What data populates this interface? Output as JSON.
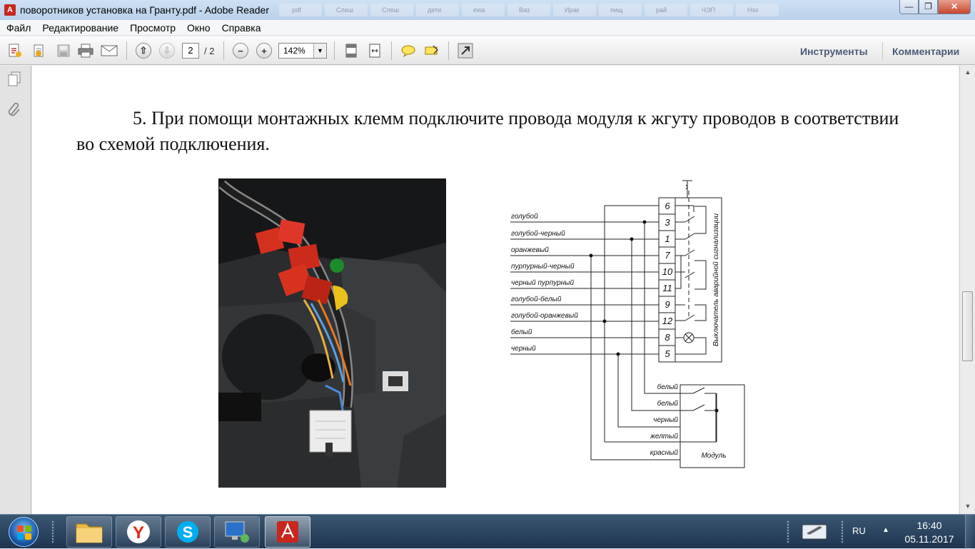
{
  "window": {
    "title": "поворотников установка на Гранту.pdf - Adobe Reader",
    "bg_tab_labels": [
      ".pdf",
      "Слеш",
      "Слеш",
      "дети",
      "ewa",
      "Ваз",
      "Ирак",
      "пищ",
      "рай",
      "ЧЭП",
      "Нэз"
    ]
  },
  "menu": {
    "items": [
      "Файл",
      "Редактирование",
      "Просмотр",
      "Окно",
      "Справка"
    ]
  },
  "toolbar": {
    "current_page": "2",
    "total_pages": "/ 2",
    "zoom": "142%",
    "tools_label": "Инструменты",
    "comments_label": "Комментарии"
  },
  "document": {
    "paragraph": "5. При помощи монтажных клемм подключите провода модуля к жгуту проводов в соответствии во схемой подключения.",
    "diagram": {
      "wire_labels": [
        "голубой",
        "голубой-черный",
        "оранжевый",
        "пурпурный-черный",
        "черный пурпурный",
        "голубой-белый",
        "голубой-оранжевый",
        "белый",
        "черный"
      ],
      "pins": [
        "6",
        "3",
        "1",
        "7",
        "10",
        "11",
        "9",
        "12",
        "8",
        "5"
      ],
      "switch_label": "Выключатель аварийной сигнализации",
      "module_wire_labels": [
        "белый",
        "белый",
        "черный",
        "желтый",
        "красный"
      ],
      "module_label": "Модуль"
    }
  },
  "taskbar": {
    "language": "RU",
    "time": "16:40",
    "date": "05.11.2017"
  }
}
